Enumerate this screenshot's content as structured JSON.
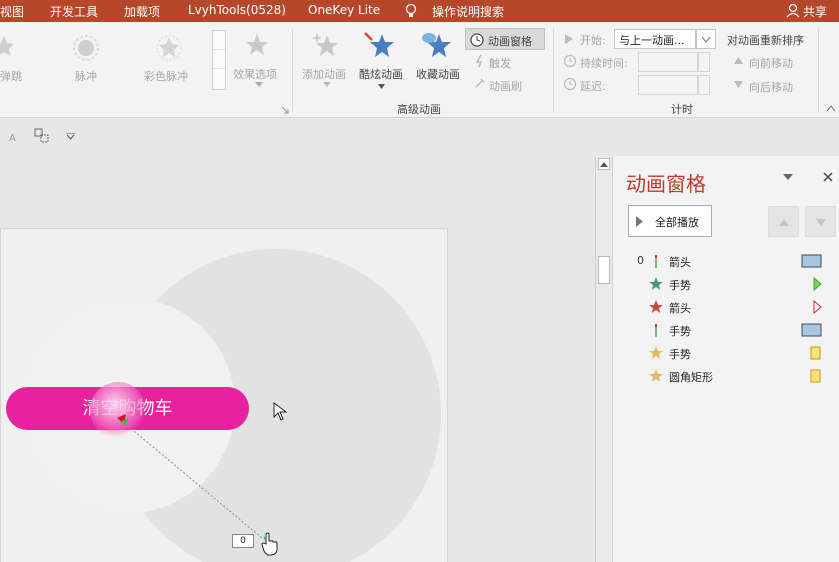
{
  "tabs": {
    "view": "视图",
    "developer": "开发工具",
    "addins": "加载项",
    "lvyh": "LvyhTools(0528)",
    "onekey": "OneKey Lite",
    "tell_me": "操作说明搜索",
    "share": "共享"
  },
  "ribbon": {
    "effects": [
      "弹跳",
      "脉冲",
      "彩色脉冲"
    ],
    "effect_options": "效果选项",
    "add_animation": "添加动画",
    "cool_animation": "酷炫动画",
    "fav_animation": "收藏动画",
    "animation_pane_btn": "动画窗格",
    "trigger": "触发",
    "animation_painter": "动画刷",
    "advanced_group": "高级动画",
    "start_label": "开始:",
    "start_value": "与上一动画...",
    "duration_label": "持续时间:",
    "delay_label": "延迟:",
    "timing_group": "计时",
    "reorder_title": "对动画重新排序",
    "move_earlier": "向前移动",
    "move_later": "向后移动"
  },
  "slide": {
    "button_text": "清空购物车",
    "path_tag": "0"
  },
  "pane": {
    "title": "动画窗格",
    "play_all": "全部播放",
    "items": [
      {
        "num": "0",
        "name": "箭头",
        "icon": "path-line-icon",
        "marker": "bar"
      },
      {
        "num": "",
        "name": "手势",
        "icon": "star-teal-icon",
        "marker": "triangle-green"
      },
      {
        "num": "",
        "name": "箭头",
        "icon": "star-red-icon",
        "marker": "triangle-red"
      },
      {
        "num": "",
        "name": "手势",
        "icon": "path-line-icon",
        "marker": "bar"
      },
      {
        "num": "",
        "name": "手势",
        "icon": "star-gold-icon",
        "marker": "bar-yellow"
      },
      {
        "num": "",
        "name": "圆角矩形",
        "icon": "star-gold-icon",
        "marker": "bar-yellow"
      }
    ]
  },
  "colors": {
    "tab_bar": "#b7472a",
    "button_pink": "#e8229e",
    "pane_title": "#c0392b"
  }
}
